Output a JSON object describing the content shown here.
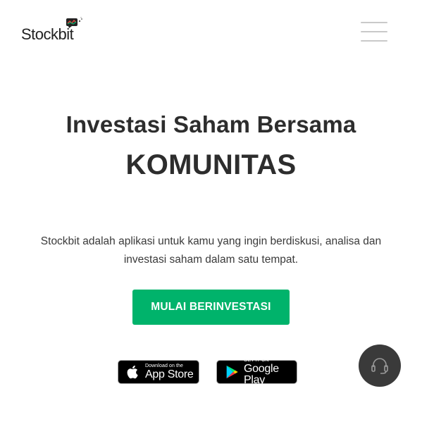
{
  "header": {
    "logo_text": "Stockbit",
    "menu_icon": "hamburger-menu-icon"
  },
  "hero": {
    "headline": "Investasi Saham Bersama",
    "headline_strong": "KOMUNITAS",
    "description": "Stockbit adalah aplikasi untuk kamu yang ingin berdiskusi, analisa dan investasi saham dalam satu tempat.",
    "cta_label": "MULAI BERINVESTASI"
  },
  "stores": {
    "apple": {
      "small": "Download on the",
      "big": "App Store",
      "icon": "apple-icon"
    },
    "google": {
      "small": "GET IT ON",
      "big": "Google Play",
      "icon": "google-play-icon"
    }
  },
  "support": {
    "icon": "headset-icon"
  },
  "colors": {
    "accent": "#00b36b",
    "text": "#2d2d2d",
    "support_bg": "#3a3a3a"
  }
}
